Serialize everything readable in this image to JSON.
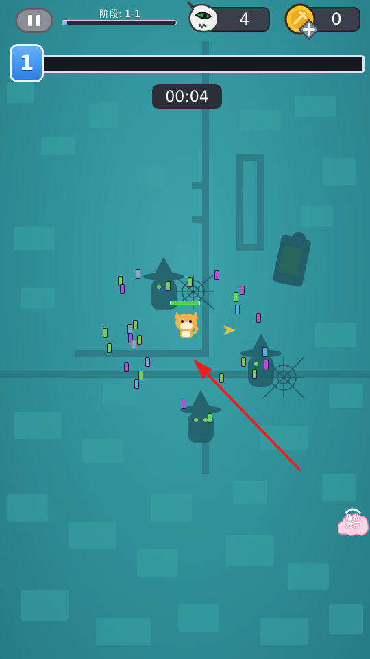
{
  "hud": {
    "stage_label": "阶段: 1-1",
    "stage_progress": 0.04,
    "kill_count": "4",
    "coin_count": "0",
    "level": "1",
    "xp_progress": 0,
    "timer": "00:04"
  },
  "side": {
    "privacy_label_line1": "隐私",
    "privacy_label_line2": "政策"
  },
  "icons": [
    "pause-icon",
    "skull-icon",
    "coin-icon",
    "plus-icon",
    "privacy-cloud-icon",
    "direction-arrow-icon"
  ],
  "colors": {
    "background": "#2f8f98",
    "arrow": "#e8231f",
    "player": "#f3b24a",
    "gem_green": "#6ad64a",
    "gem_purple": "#b44fd6",
    "gem_blue": "#6aa9e8",
    "health": "#58d04e"
  }
}
